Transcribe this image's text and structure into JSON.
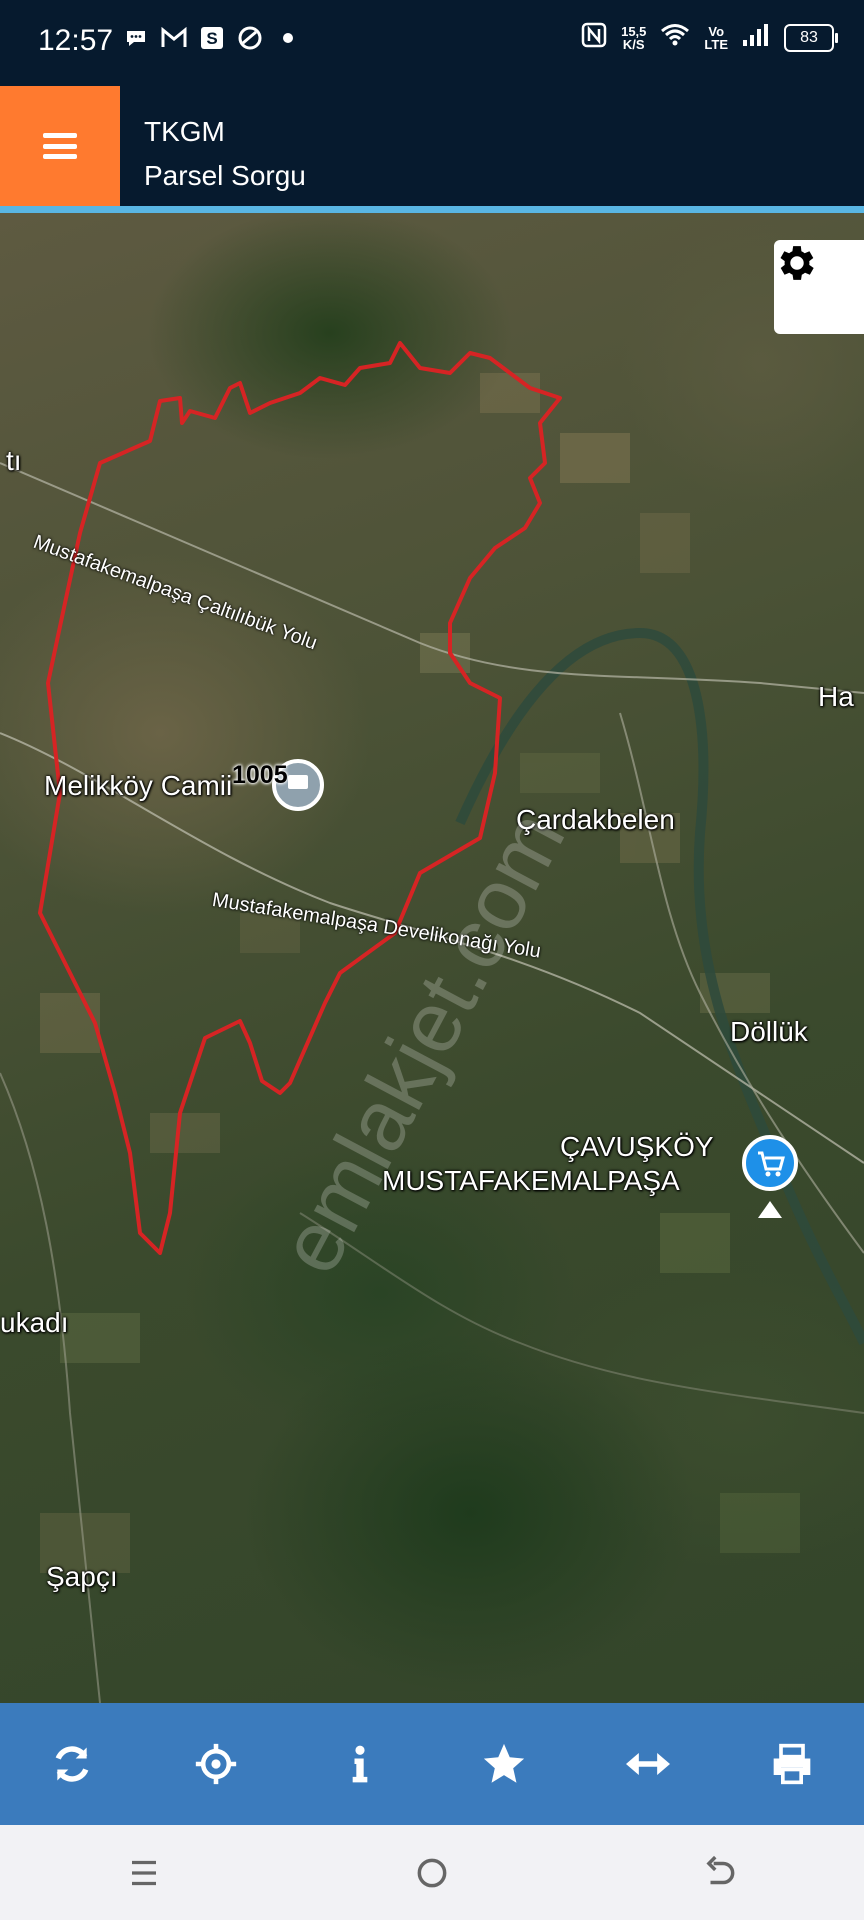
{
  "status_bar": {
    "time": "12:57",
    "net_speed": "15,5",
    "net_unit": "K/S",
    "volte_top": "Vo",
    "volte_bottom": "LTE",
    "battery": "83",
    "left_icons": [
      "chat-icon",
      "gmail-icon",
      "s-app-icon",
      "app-icon",
      "dot-icon"
    ],
    "right_icons": [
      "nfc-icon",
      "wifi-icon",
      "signal-icon",
      "battery-icon"
    ]
  },
  "header": {
    "title": "TKGM",
    "subtitle": "Parsel Sorgu",
    "accent_color": "#ff7a2f",
    "bg_color": "#061a2e"
  },
  "map": {
    "parcel_number": "1005",
    "parcel_outline_color": "#d62424",
    "watermark": "emlakjet.com",
    "place_labels": {
      "melikkoy": "Melikköy Camii",
      "cardakbelen": "Çardakbelen",
      "dolluk": "Döllük",
      "cavuskoy_line1": "ÇAVUŞKÖY",
      "cavuskoy_line2": "MUSTAFAKEMALPAŞA",
      "ukadi": "ukadı",
      "sapci": "Şapçı",
      "ti": "tı",
      "ha": "Ha"
    },
    "road_labels": {
      "road1": "Mustafakemalpaşa Çaltılıbük Yolu",
      "road2": "Mustafakemalpaşa Develikonağı Yolu"
    }
  },
  "toolbar": {
    "items": [
      "refresh-icon",
      "locate-icon",
      "info-icon",
      "star-icon",
      "measure-icon",
      "print-icon"
    ]
  },
  "nav": {
    "items": [
      "recent-apps-icon",
      "home-icon",
      "back-icon"
    ]
  }
}
